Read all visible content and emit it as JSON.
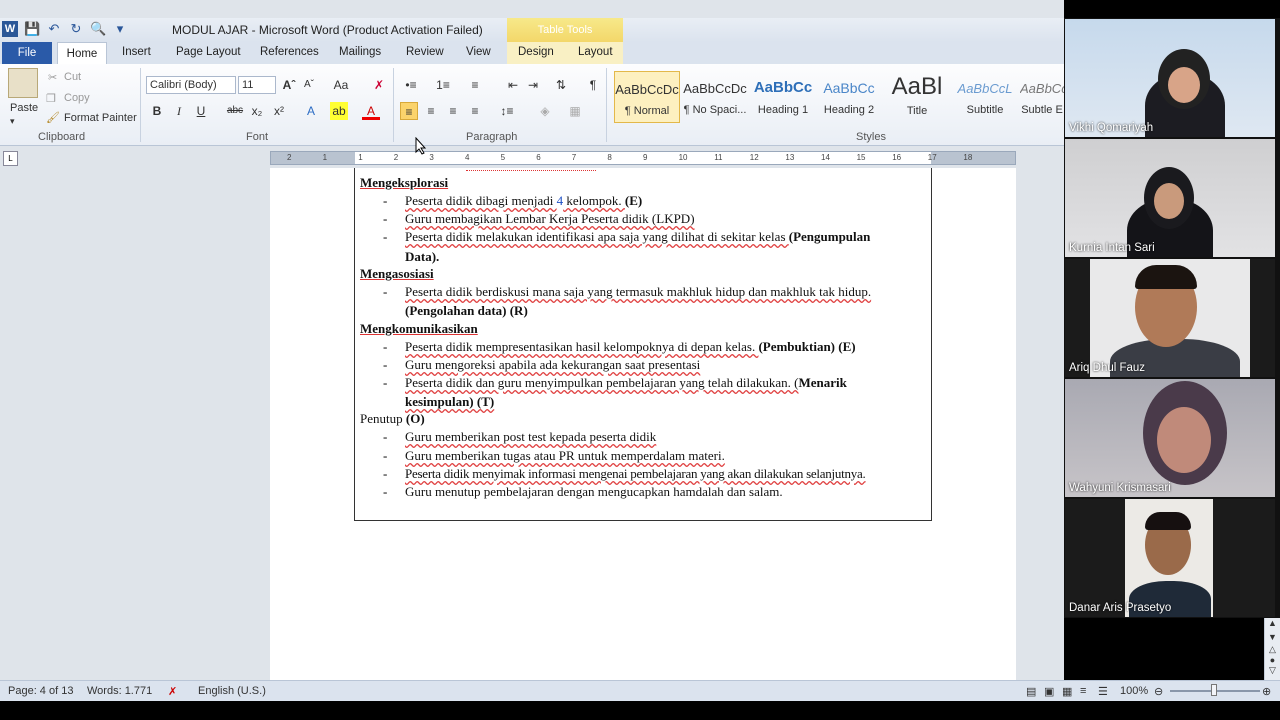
{
  "window": {
    "title": "MODUL AJAR  -  Microsoft Word (Product Activation Failed)",
    "table_tools_label": "Table Tools"
  },
  "tabs": [
    {
      "label": "File"
    },
    {
      "label": "Home"
    },
    {
      "label": "Insert"
    },
    {
      "label": "Page Layout"
    },
    {
      "label": "References"
    },
    {
      "label": "Mailings"
    },
    {
      "label": "Review"
    },
    {
      "label": "View"
    },
    {
      "label": "Design"
    },
    {
      "label": "Layout"
    }
  ],
  "clipboard": {
    "paste": "Paste",
    "cut": "Cut",
    "copy": "Copy",
    "format_painter": "Format Painter",
    "group": "Clipboard"
  },
  "font": {
    "name": "Calibri (Body)",
    "size": "11",
    "group": "Font"
  },
  "paragraph": {
    "group": "Paragraph"
  },
  "styles": {
    "group": "Styles",
    "items": [
      {
        "preview": "AaBbCcDc",
        "name": "¶ Normal"
      },
      {
        "preview": "AaBbCcDc",
        "name": "¶ No Spaci..."
      },
      {
        "preview": "AaBbCc",
        "name": "Heading 1"
      },
      {
        "preview": "AaBbCc",
        "name": "Heading 2"
      },
      {
        "preview": "AaBl",
        "name": "Title"
      },
      {
        "preview": "AaBbCcL",
        "name": "Subtitle"
      },
      {
        "preview": "AaBbCc",
        "name": "Subtle E"
      }
    ]
  },
  "ruler": {
    "numbers": [
      "2",
      "1",
      "1",
      "2",
      "3",
      "4",
      "5",
      "6",
      "7",
      "8",
      "9",
      "10",
      "11",
      "12",
      "13",
      "14",
      "15",
      "16",
      "17",
      "18"
    ]
  },
  "document": {
    "h1": "Mengeksplorasi",
    "l1a": "Peserta didik dibagi menjadi ",
    "l1num": "4",
    "l1b": " kelompok. ",
    "l1tag": "(E)",
    "l2": "Guru membagikan Lembar Kerja Peserta didik (LKPD)",
    "l3a": "Peserta didik melakukan identifikasi apa saja yang dilihat di sekitar kelas ",
    "l3tag": "(Pengumpulan",
    "l3cont": "Data).",
    "h2": "Mengasosiasi",
    "l4": "Peserta didik berdiskusi mana saja yang termasuk makhluk hidup dan makhluk tak hidup.",
    "l4cont": "(Pengolahan data)  (R)",
    "h3": "Mengkomunikasikan",
    "l5a": "Peserta didik mempresentasikan hasil kelompoknya di depan kelas. ",
    "l5tag": "(Pembuktian) (E)",
    "l6": "Guru mengoreksi apabila ada kekurangan saat presentasi",
    "l7a": "Peserta didik dan guru menyimpulkan  pembelajaran yang telah dilakukan. (",
    "l7tag": "Menarik",
    "l7cont": "kesimpulan) (T)",
    "h4a": "Penutup ",
    "h4tag": "(O)",
    "l8": "Guru memberikan post test kepada peserta didik",
    "l9": "Guru memberikan tugas atau PR untuk memperdalam materi.",
    "l10": "Peserta didik menyimak informasi mengenai pembelajaran yang akan dilakukan selanjutnya.",
    "l11": "Guru menutup pembelajaran dengan mengucapkan hamdalah dan salam.",
    "dash": "-"
  },
  "status": {
    "page": "Page: 4 of 13",
    "words": "Words: 1.771",
    "language": "English (U.S.)",
    "zoom": "100%"
  },
  "participants": [
    {
      "name": "Vikhi Qomariyah"
    },
    {
      "name": "Kurnia Intan Sari"
    },
    {
      "name": "Ariq Dhul Fauz"
    },
    {
      "name": "Wahyuni Krismasari"
    },
    {
      "name": "Danar Aris Prasetyo"
    }
  ],
  "colors": {
    "file_tab": "#2a5aa8",
    "table_tools": "#f3d76a",
    "spell_error": "#e04040"
  }
}
